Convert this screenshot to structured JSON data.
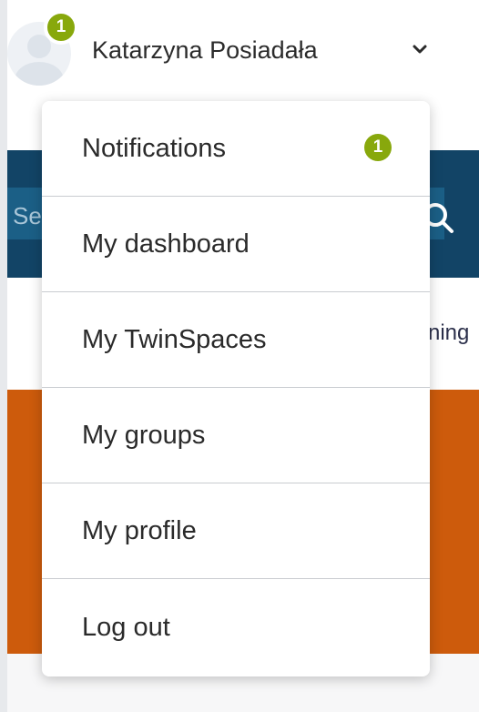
{
  "header": {
    "user_name": "Katarzyna Posiadała",
    "notification_count": "1"
  },
  "search": {
    "placeholder": "Sea"
  },
  "nav_fragment": "ning",
  "menu": {
    "items": [
      {
        "label": "Notifications",
        "badge": "1"
      },
      {
        "label": "My dashboard"
      },
      {
        "label": "My TwinSpaces"
      },
      {
        "label": "My groups"
      },
      {
        "label": "My profile"
      },
      {
        "label": "Log out"
      }
    ]
  },
  "colors": {
    "badge": "#88a80c",
    "search_bar": "#124466",
    "banner": "#cd5b0c",
    "text": "#2a2a2a"
  },
  "icons": {
    "chevron": "chevron-down-icon",
    "search": "search-icon",
    "avatar": "user-avatar-icon"
  }
}
